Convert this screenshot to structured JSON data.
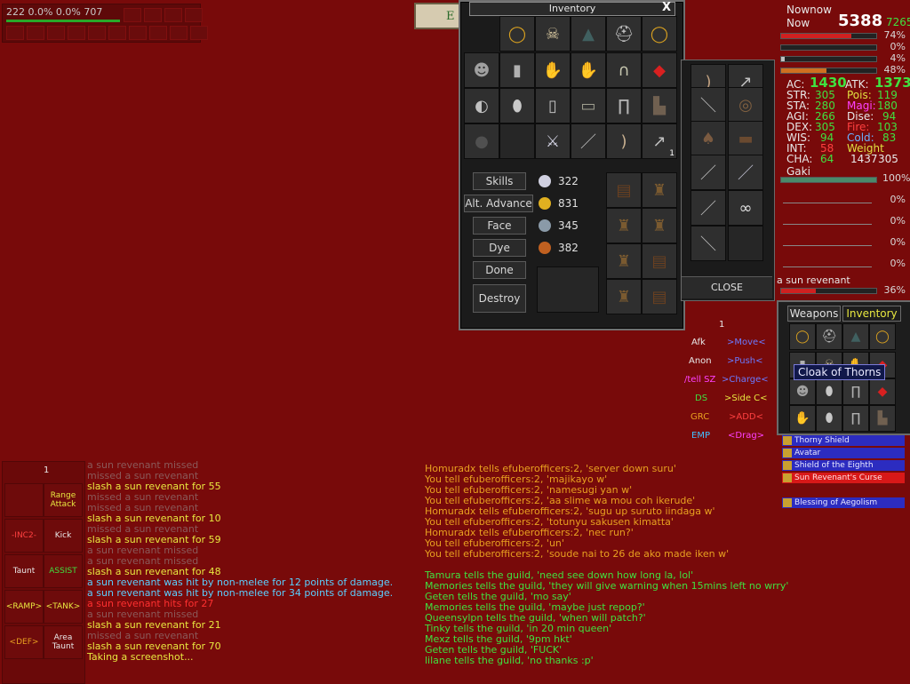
{
  "top_strip": {
    "values": "222   0.0%  0.0%  707"
  },
  "compass": {
    "mark": "E"
  },
  "inventory": {
    "title": "Inventory",
    "close_x": "X",
    "buttons": [
      "Skills",
      "Alt. Advance",
      "Face",
      "Dye",
      "Done",
      "Destroy"
    ],
    "coins": [
      {
        "name": "platinum",
        "value": "322",
        "color": "#d0d0e0"
      },
      {
        "name": "gold",
        "value": "831",
        "color": "#e0b020"
      },
      {
        "name": "silver",
        "value": "345",
        "color": "#8a9aa8"
      },
      {
        "name": "copper",
        "value": "382",
        "color": "#c06020"
      }
    ],
    "slot_qty": {
      "range_slot": "1"
    }
  },
  "bags": {
    "close_label": "CLOSE",
    "qty_label": "1"
  },
  "stats": {
    "name1": "Nownow",
    "name2": "Now",
    "hp_current": "5388",
    "hp_max": "7265",
    "bars": [
      {
        "pct": "74%",
        "color": "#d02020",
        "fill": 0.74
      },
      {
        "pct": "0%",
        "color": "#2040d0",
        "fill": 0.0
      },
      {
        "pct": "4%",
        "color": "#c0c0c0",
        "fill": 0.04
      },
      {
        "pct": "48%",
        "color": "#d07020",
        "fill": 0.48
      }
    ],
    "ac_label": "AC:",
    "ac": "1430",
    "atk_label": "ATK:",
    "atk": "1373",
    "attrs": [
      {
        "l": "STR:",
        "v": "305",
        "r": "Pois:",
        "rv": "119"
      },
      {
        "l": "STA:",
        "v": "280",
        "r": "Magi:",
        "rv": "180"
      },
      {
        "l": "AGI:",
        "v": "266",
        "r": "Dise:",
        "rv": "94"
      },
      {
        "l": "DEX:",
        "v": "305",
        "r": "Fire:",
        "rv": "103"
      },
      {
        "l": "WIS:",
        "v": "94",
        "r": "Cold:",
        "rv": "83"
      },
      {
        "l": "INT:",
        "v": "58",
        "r": "Weight",
        "rv": ""
      },
      {
        "l": "CHA:",
        "v": "64",
        "r": "1437",
        "rv": "305"
      }
    ],
    "pet_name": "Gaki",
    "pet_pct": "100%",
    "group_pcts": [
      "0%",
      "0%",
      "0%",
      "0%"
    ],
    "target_name": "a sun revenant",
    "target_pct": "36%"
  },
  "hotkeys": {
    "page": "1",
    "rows": [
      {
        "a": "Afk",
        "ac": "#e8e8e8",
        "b": ">Move<",
        "bc": "#6a7aff"
      },
      {
        "a": "Anon",
        "ac": "#e8e8e8",
        "b": ">Push<",
        "bc": "#6a7aff"
      },
      {
        "a": "/tell SZ",
        "ac": "#ff40ff",
        "b": ">Charge<",
        "bc": "#6a7aff"
      },
      {
        "a": "DS",
        "ac": "#40e040",
        "b": ">Side C<",
        "bc": "#e8e840"
      },
      {
        "a": "GRC",
        "ac": "#e8a020",
        "b": ">ADD<",
        "bc": "#ff4040"
      },
      {
        "a": "EMP",
        "ac": "#40c0ff",
        "b": "<Drag>",
        "bc": "#ff40ff"
      }
    ]
  },
  "mini_inventory": {
    "tab_weapons": "Weapons",
    "tab_inventory": "Inventory",
    "tooltip": "Cloak of Thorns"
  },
  "buffs": [
    "Thorny Shield",
    "Avatar",
    "Shield of the Eighth",
    "Sun Revenant's Curse",
    "Blessing of Aegolism"
  ],
  "hotbar": {
    "page": "1",
    "buttons": [
      "",
      "Range Attack",
      "-INC2-",
      "Kick",
      "Taunt",
      "ASSIST",
      "<RAMP>",
      "<TANK>",
      "<DEF>",
      "Area Taunt"
    ]
  },
  "combat_chat": [
    {
      "t": "a sun revenant missed",
      "c": "#8a5a5a"
    },
    {
      "t": "missed a sun revenant",
      "c": "#8a5a5a"
    },
    {
      "t": "slash a sun revenant for 55",
      "c": "#e8e840"
    },
    {
      "t": "missed a sun revenant",
      "c": "#8a5a5a"
    },
    {
      "t": "missed a sun revenant",
      "c": "#8a5a5a"
    },
    {
      "t": "slash a sun revenant for 10",
      "c": "#e8e840"
    },
    {
      "t": "missed a sun revenant",
      "c": "#8a5a5a"
    },
    {
      "t": "slash a sun revenant for 59",
      "c": "#e8e840"
    },
    {
      "t": "a sun revenant missed",
      "c": "#8a5a5a"
    },
    {
      "t": "a sun revenant missed",
      "c": "#8a5a5a"
    },
    {
      "t": "slash a sun revenant for 48",
      "c": "#e8e840"
    },
    {
      "t": "a sun revenant was hit by non-melee for 12 points of damage.",
      "c": "#5ad0ff"
    },
    {
      "t": "a sun revenant was hit by non-melee for 34 points of damage.",
      "c": "#5ad0ff"
    },
    {
      "t": "a sun revenant hits for 27",
      "c": "#ff3030"
    },
    {
      "t": "a sun revenant missed",
      "c": "#8a5a5a"
    },
    {
      "t": "slash a sun revenant for 21",
      "c": "#e8e840"
    },
    {
      "t": "missed a sun revenant",
      "c": "#8a5a5a"
    },
    {
      "t": "slash a sun revenant for 70",
      "c": "#e8e840"
    },
    {
      "t": "Taking a screenshot...",
      "c": "#e8e840"
    }
  ],
  "tell_chat": [
    {
      "t": "Homuradx tells efuberofficers:2, 'server down suru'",
      "c": "#e8a020"
    },
    {
      "t": "You tell efuberofficers:2, 'majikayo w'",
      "c": "#e8a020"
    },
    {
      "t": "You tell efuberofficers:2, 'namesugi yan w'",
      "c": "#e8a020"
    },
    {
      "t": "You tell efuberofficers:2, 'aa slime wa mou coh ikerude'",
      "c": "#e8a020"
    },
    {
      "t": "Homuradx tells efuberofficers:2, 'sugu up suruto iindaga w'",
      "c": "#e8a020"
    },
    {
      "t": "You tell efuberofficers:2, 'totunyu sakusen kimatta'",
      "c": "#e8a020"
    },
    {
      "t": "Homuradx tells efuberofficers:2, 'nec run?'",
      "c": "#e8a020"
    },
    {
      "t": "You tell efuberofficers:2, 'un'",
      "c": "#e8a020"
    },
    {
      "t": "You tell efuberofficers:2, 'soude nai to 26 de ako made iken w'",
      "c": "#e8a020"
    },
    {
      "t": "",
      "c": "#e8a020"
    },
    {
      "t": "Tamura tells the guild, 'need see down how long la, lol'",
      "c": "#40e040"
    },
    {
      "t": "Memories tells the guild, 'they will give warning when 15mins left no wrry'",
      "c": "#40e040"
    },
    {
      "t": "Geten tells the guild, 'mo say'",
      "c": "#40e040"
    },
    {
      "t": "Memories tells the guild, 'maybe just repop?'",
      "c": "#40e040"
    },
    {
      "t": "Queensylpn tells the guild, 'when will patch?'",
      "c": "#40e040"
    },
    {
      "t": "Tinky tells the guild, 'in 20 min queen'",
      "c": "#40e040"
    },
    {
      "t": "Mexz tells the guild, '9pm hkt'",
      "c": "#40e040"
    },
    {
      "t": "Geten tells the guild, 'FUCK'",
      "c": "#40e040"
    },
    {
      "t": "lilane tells the guild, 'no thanks :p'",
      "c": "#40e040"
    }
  ],
  "icons": {
    "slot_icons": [
      "ring-icon",
      "skull-icon",
      "cloak-icon",
      "helmet-icon",
      "ring-icon",
      "mask-icon",
      "armor-icon",
      "gauntlet-icon",
      "glove-icon",
      "cloak-icon",
      "shield-icon",
      "shoulder-icon",
      "breastplate-icon",
      "belt-icon",
      "leg-armor-icon",
      "boot-icon",
      "charm-icon",
      "sword-icon",
      "sword-icon",
      "bow-icon",
      "arrow-icon"
    ]
  }
}
